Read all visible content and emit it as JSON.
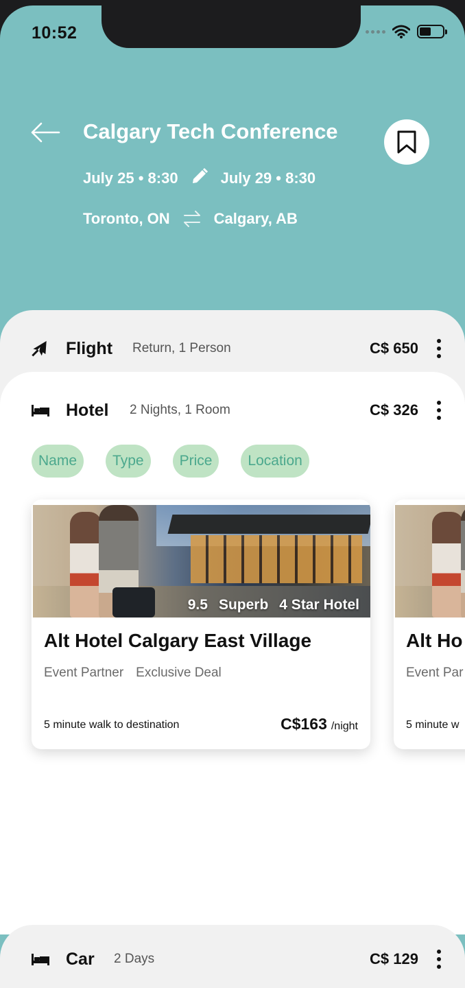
{
  "status": {
    "time": "10:52"
  },
  "trip": {
    "title": "Calgary Tech Conference",
    "depart": "July 25 • 8:30",
    "return": "July 29 • 8:30",
    "origin": "Toronto, ON",
    "destination": "Calgary, AB"
  },
  "flight": {
    "label": "Flight",
    "detail": "Return, 1 Person",
    "price": "C$ 650"
  },
  "hotel": {
    "label": "Hotel",
    "detail": "2 Nights, 1 Room",
    "price": "C$ 326",
    "filters": [
      "Name",
      "Type",
      "Price",
      "Location"
    ],
    "cards": [
      {
        "rating": "9.5",
        "rating_text": "Superb",
        "stars": "4 Star Hotel",
        "name": "Alt Hotel Calgary East Village",
        "tag1": "Event Partner",
        "tag2": "Exclusive Deal",
        "walk": "5 minute walk to destination",
        "price": "C$163",
        "unit": "/night"
      },
      {
        "rating": "",
        "rating_text": "",
        "stars": "",
        "name": "Alt Ho",
        "tag1": "Event Par",
        "tag2": "",
        "walk": "5 minute w",
        "price": "",
        "unit": ""
      }
    ]
  },
  "car": {
    "label": "Car",
    "detail": "2 Days",
    "price": "C$ 129"
  },
  "colors": {
    "header_bg": "#7bbfc0",
    "chip_bg": "#bfe3c4",
    "chip_text": "#4ba88d"
  },
  "icons": [
    "back-arrow-icon",
    "bookmark-icon",
    "edit-pencil-icon",
    "swap-arrows-icon",
    "airplane-icon",
    "bed-icon",
    "more-vertical-icon",
    "wifi-icon",
    "battery-icon"
  ]
}
